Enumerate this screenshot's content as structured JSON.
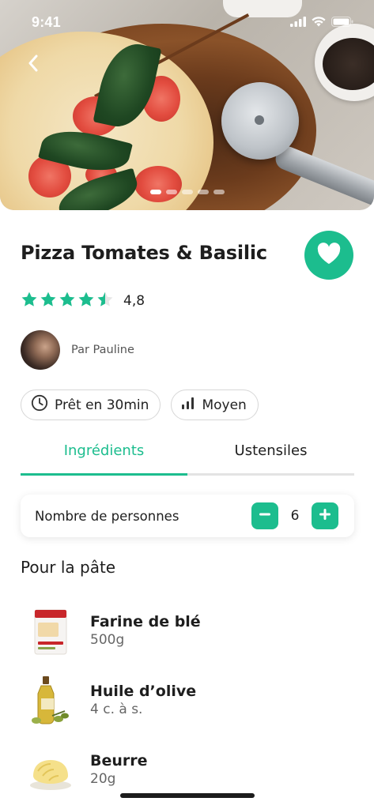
{
  "status_bar": {
    "time": "9:41"
  },
  "hero": {
    "photo_description_icon": "pizza-photo",
    "carousel_dots": 5,
    "active_dot": 0
  },
  "recipe": {
    "title": "Pizza Tomates & Basilic",
    "rating_value": "4,8",
    "rating_stars": 4.5,
    "author_label": "Par Pauline",
    "chips": [
      {
        "icon": "clock-icon",
        "label": "Prêt en 30min"
      },
      {
        "icon": "bar-chart-icon",
        "label": "Moyen"
      }
    ]
  },
  "tabs": [
    {
      "label": "Ingrédients",
      "active": true
    },
    {
      "label": "Ustensiles",
      "active": false
    }
  ],
  "servings": {
    "label": "Nombre de personnes",
    "value": "6"
  },
  "section": {
    "title": "Pour la pâte"
  },
  "ingredients": [
    {
      "name": "Farine de blé",
      "qty": "500g",
      "icon": "flour-pack-icon"
    },
    {
      "name": "Huile d’olive",
      "qty": "4 c. à s.",
      "icon": "olive-oil-icon"
    },
    {
      "name": "Beurre",
      "qty": "20g",
      "icon": "butter-icon"
    }
  ],
  "colors": {
    "accent": "#1cbd8e",
    "star": "#1cbd8e"
  }
}
